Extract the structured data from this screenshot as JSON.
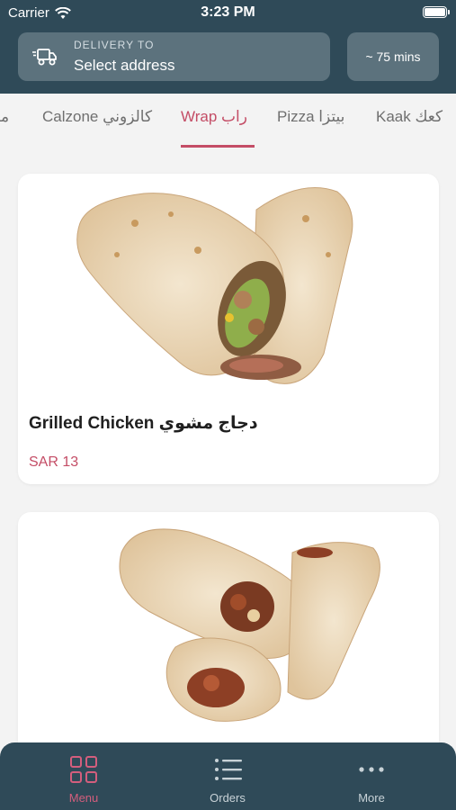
{
  "status_bar": {
    "carrier": "Carrier",
    "time": "3:23 PM"
  },
  "header": {
    "delivery_label": "DELIVERY TO",
    "address_value": "Select address",
    "eta": "~ 75 mins"
  },
  "tabs": [
    {
      "label": "من",
      "active": false
    },
    {
      "label": "Calzone كالزوني",
      "active": false
    },
    {
      "label": "Wrap راب",
      "active": true
    },
    {
      "label": "Pizza بيتزا",
      "active": false
    },
    {
      "label": "Kaak كعك",
      "active": false
    }
  ],
  "products": [
    {
      "name": "Grilled Chicken دجاج مشوي",
      "price": "SAR 13"
    },
    {
      "name": "",
      "price": ""
    }
  ],
  "nav": [
    {
      "label": "Menu",
      "icon": "grid-icon",
      "active": true
    },
    {
      "label": "Orders",
      "icon": "list-icon",
      "active": false
    },
    {
      "label": "More",
      "icon": "more-dots-icon",
      "active": false
    }
  ],
  "colors": {
    "header_bg": "#2f4a58",
    "accent": "#c44d66",
    "button_bg": "#5c727d"
  }
}
